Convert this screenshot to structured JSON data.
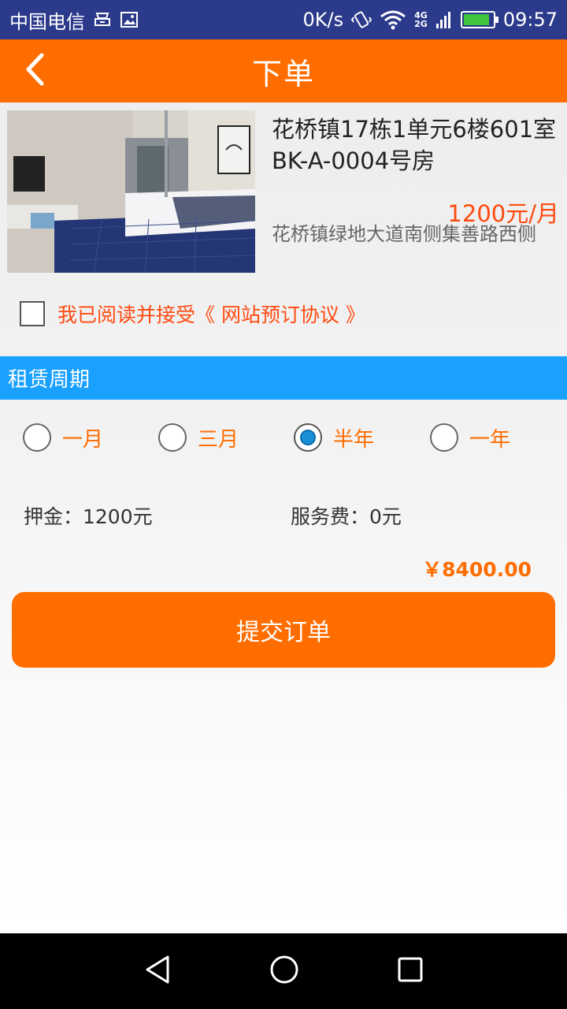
{
  "status_bar": {
    "carrier": "中国电信",
    "net_speed": "0K/s",
    "net_4g": "4G",
    "net_2g": "2G",
    "time": "09:57",
    "battery_level": 0.9,
    "icons": [
      "notification-icon",
      "image-icon",
      "vibrate-icon",
      "wifi-icon",
      "signal-icon",
      "battery-icon"
    ]
  },
  "app_bar": {
    "title": "下单",
    "back_icon": "chevron-left-icon"
  },
  "listing": {
    "title": "花桥镇17栋1单元6楼601室BK-A-0004号房",
    "price": "1200元/月",
    "address": "花桥镇绿地大道南侧集善路西侧"
  },
  "agreement": {
    "checked": false,
    "text": "我已阅读并接受《 网站预订协议 》"
  },
  "rental_period": {
    "header": "租赁周期",
    "options": [
      {
        "label": "一月",
        "checked": false
      },
      {
        "label": "三月",
        "checked": false
      },
      {
        "label": "半年",
        "checked": true
      },
      {
        "label": "一年",
        "checked": false
      }
    ]
  },
  "fees": {
    "deposit": "押金：1200元",
    "service": "服务费：0元",
    "total": "￥8400.00"
  },
  "submit": {
    "label": "提交订单"
  },
  "colors": {
    "status_bar": "#2c3a8c",
    "accent": "#ff6d00",
    "price": "#ff4a10",
    "section_header": "#1aa0ff",
    "radio_checked": "#1a8fd8"
  }
}
